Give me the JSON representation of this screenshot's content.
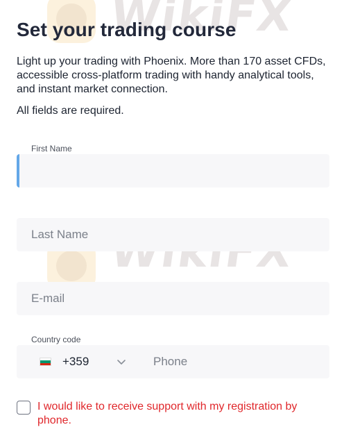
{
  "form": {
    "title": "Set your trading course",
    "intro": "Light up your trading with Phoenix. More than 170 asset CFDs, accessible cross-platform trading with handy analytical tools, and instant market connection.",
    "required_note": "All fields are required.",
    "first_name": {
      "label": "First Name",
      "value": "",
      "placeholder": ""
    },
    "last_name": {
      "placeholder": "Last Name",
      "value": ""
    },
    "email": {
      "placeholder": "E-mail",
      "value": ""
    },
    "country_code": {
      "label": "Country code",
      "value": "+359",
      "flag": "bulgaria-flag",
      "flag_colors": [
        "#ffffff",
        "#00966e",
        "#d62612"
      ]
    },
    "phone": {
      "placeholder": "Phone",
      "value": ""
    },
    "support_consent": {
      "label": "I would like to receive support with my registration by phone.",
      "checked": false
    }
  },
  "watermark": {
    "text": "WikiFX",
    "icon": "wikifx-logo-icon"
  },
  "colors": {
    "error_text": "#e0272b",
    "focus_border": "#63a7e8",
    "field_bg": "#f7f7f9"
  }
}
